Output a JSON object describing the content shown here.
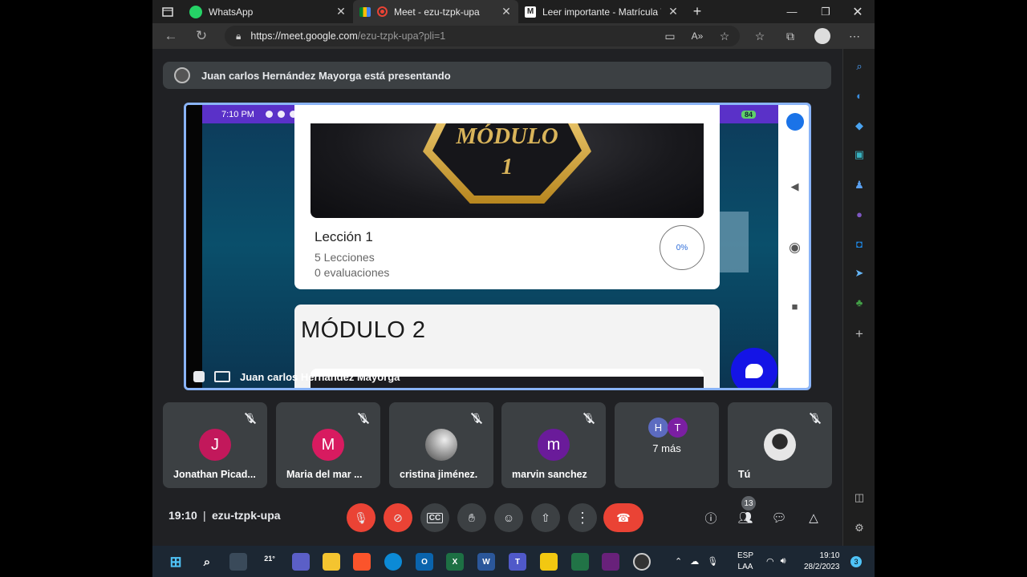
{
  "browser": {
    "tabs": [
      {
        "label": "WhatsApp",
        "icon": "whatsapp-icon",
        "color": "#25d366"
      },
      {
        "label": "Meet - ezu-tzpk-upa",
        "icon": "meet-icon",
        "color": "#ea4335"
      },
      {
        "label": "Leer importante - Matrícula Virtu",
        "icon": "moodle-icon",
        "color": "#ffffff"
      }
    ],
    "url_host": "https://meet.google.com",
    "url_path": "/ezu-tzpk-upa?pli=1"
  },
  "meet": {
    "banner": "Juan carlos Hernández Mayorga está presentando",
    "presenter_name": "Juan carlos Hernández Mayorga",
    "clock": "19:10",
    "separator": "|",
    "meeting_code": "ezu-tzpk-upa",
    "participants_count": "13",
    "accent_red": "#ea4335",
    "tile_bg": "#3c4043"
  },
  "phone": {
    "time": "7:10 PM",
    "battery": "84",
    "module1_title_line1": "MÓDULO",
    "module1_title_line2": "1",
    "lesson_title": "Lección 1",
    "lesson_count": "5 Lecciones",
    "eval_count": "0 evaluaciones",
    "progress": "0%",
    "module2_title": "MÓDULO 2"
  },
  "tiles": [
    {
      "name": "Jonathan Picad...",
      "initial": "J",
      "color": "#c2185b"
    },
    {
      "name": "Maria del mar ...",
      "initial": "M",
      "color": "#d81b60"
    },
    {
      "name": "cristina jiménez.",
      "initial": "",
      "color": "#8d8d8d"
    },
    {
      "name": "marvin sanchez",
      "initial": "m",
      "color": "#6a1b9a"
    },
    {
      "name": "7 más",
      "initial": "",
      "color": "#3c4043"
    },
    {
      "name": "Tú",
      "initial": "",
      "color": "#cfd8dc"
    }
  ],
  "more_tile": {
    "avatars": [
      {
        "initial": "H",
        "color": "#5c6bc0"
      },
      {
        "initial": "T",
        "color": "#7b1fa2"
      }
    ]
  },
  "taskbar": {
    "weather": "21°",
    "lang_line1": "ESP",
    "lang_line2": "LAA",
    "time": "19:10",
    "date": "28/2/2023",
    "notif": "3"
  }
}
